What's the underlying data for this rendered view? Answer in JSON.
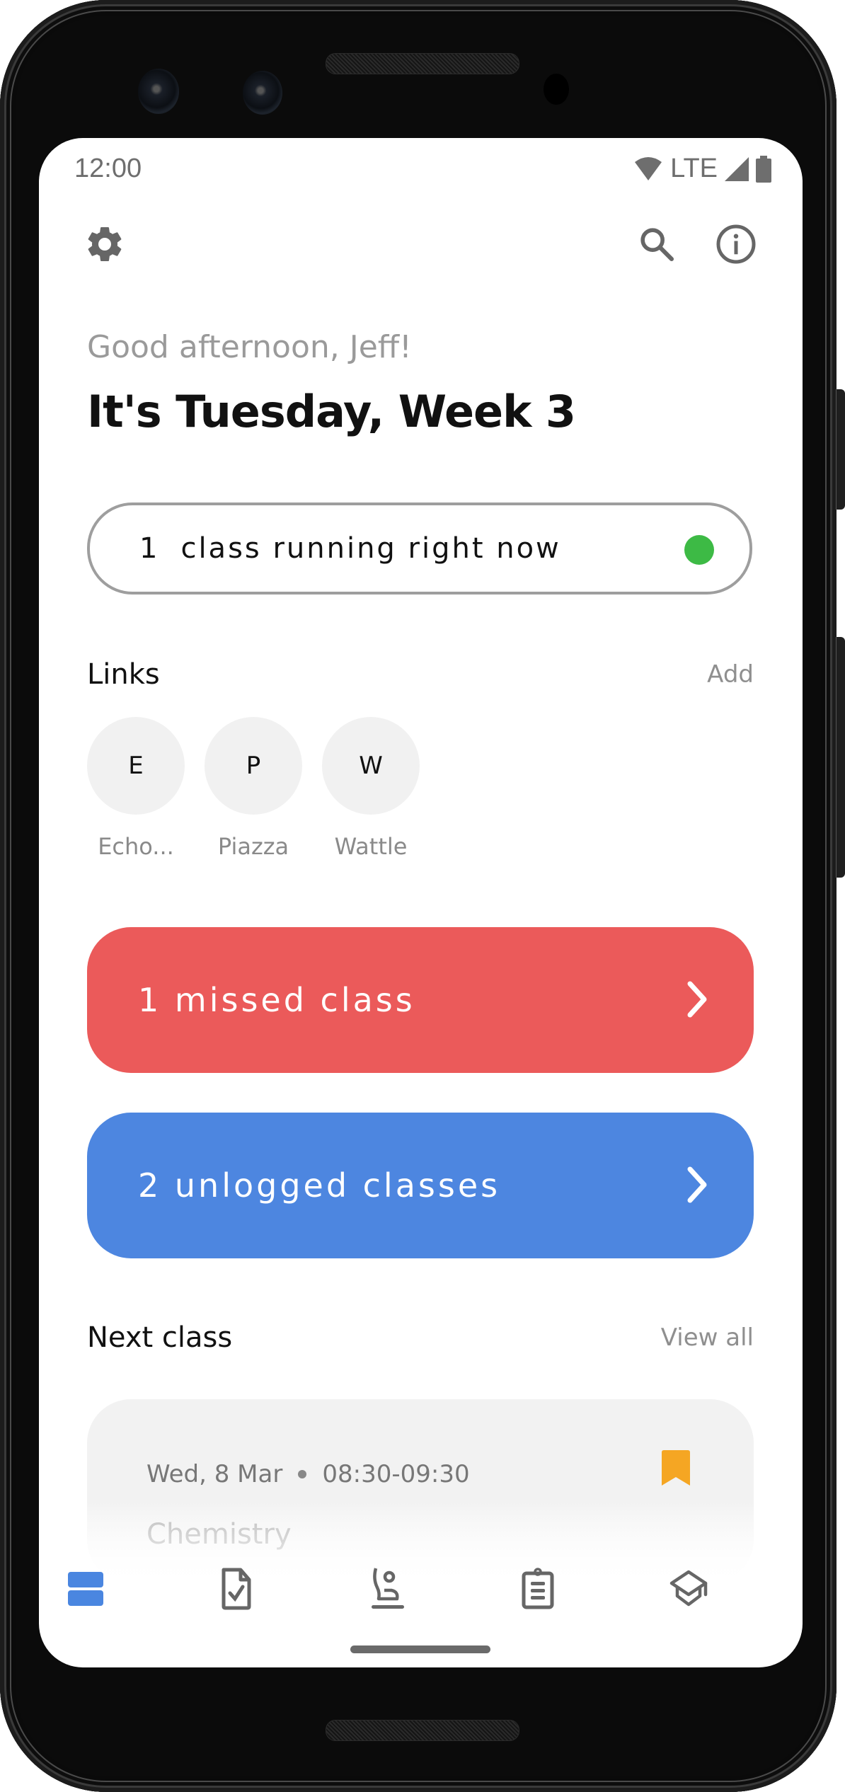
{
  "status_bar": {
    "time": "12:00",
    "network": "LTE",
    "icons": [
      "wifi-icon",
      "signal-icon",
      "battery-icon"
    ]
  },
  "toolbar": {
    "settings_icon": "gear-icon",
    "search_icon": "search-icon",
    "info_icon": "info-icon"
  },
  "header": {
    "greeting": "Good afternoon, Jeff!",
    "title": "It's Tuesday, Week 3"
  },
  "running_now": {
    "count": "1",
    "label": "class running right now",
    "indicator_color": "#3dba45"
  },
  "links": {
    "heading": "Links",
    "action": "Add",
    "items": [
      {
        "initial": "E",
        "label": "Echo..."
      },
      {
        "initial": "P",
        "label": "Piazza"
      },
      {
        "initial": "W",
        "label": "Wattle"
      }
    ]
  },
  "alerts": [
    {
      "label": "1 missed class",
      "color": "#eb5a5a"
    },
    {
      "label": "2 unlogged classes",
      "color": "#4d86e0"
    }
  ],
  "next_class": {
    "heading": "Next class",
    "action": "View all",
    "card": {
      "date": "Wed, 8 Mar",
      "time": "08:30-09:30",
      "subject": "Chemistry",
      "bookmark_color": "#f5a623"
    }
  },
  "bottom_nav": {
    "items": [
      {
        "icon": "dashboard-icon",
        "active": true
      },
      {
        "icon": "document-check-icon",
        "active": false
      },
      {
        "icon": "attendance-icon",
        "active": false
      },
      {
        "icon": "clipboard-icon",
        "active": false
      },
      {
        "icon": "graduation-cap-icon",
        "active": false
      }
    ],
    "active_color": "#4a86e0",
    "inactive_color": "#666666"
  }
}
